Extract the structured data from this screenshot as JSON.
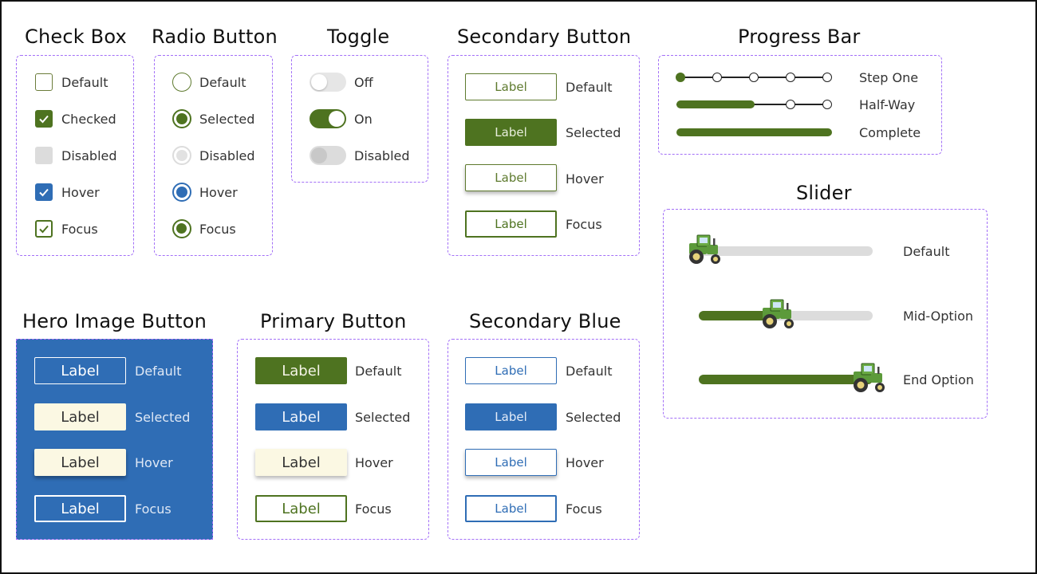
{
  "sections": {
    "checkbox": {
      "title": "Check Box",
      "items": [
        "Default",
        "Checked",
        "Disabled",
        "Hover",
        "Focus"
      ]
    },
    "radio": {
      "title": "Radio Button",
      "items": [
        "Default",
        "Selected",
        "Disabled",
        "Hover",
        "Focus"
      ]
    },
    "toggle": {
      "title": "Toggle",
      "items": [
        "Off",
        "On",
        "Disabled"
      ]
    },
    "secondary": {
      "title": "Secondary Button",
      "button_label": "Label",
      "items": [
        "Default",
        "Selected",
        "Hover",
        "Focus"
      ]
    },
    "progress": {
      "title": "Progress Bar",
      "items": [
        "Step One",
        "Half-Way",
        "Complete"
      ],
      "values": [
        0.0,
        0.5,
        1.0
      ]
    },
    "slider": {
      "title": "Slider",
      "items": [
        "Default",
        "Mid-Option",
        "End Option"
      ],
      "values": [
        0.0,
        0.45,
        1.0
      ]
    },
    "hero": {
      "title": "Hero Image Button",
      "button_label": "Label",
      "items": [
        "Default",
        "Selected",
        "Hover",
        "Focus"
      ]
    },
    "primary": {
      "title": "Primary Button",
      "button_label": "Label",
      "items": [
        "Default",
        "Selected",
        "Hover",
        "Focus"
      ]
    },
    "secondary_blue": {
      "title": "Secondary Blue",
      "button_label": "Label",
      "items": [
        "Default",
        "Selected",
        "Hover",
        "Focus"
      ]
    }
  },
  "colors": {
    "green": "#4e7320",
    "blue": "#2f6db5",
    "cream": "#fbf8e3",
    "dashed_border": "#a370f7",
    "disabled_gray": "#dcdcdc"
  },
  "icons": {
    "check": "check-icon",
    "slider_thumb": "tractor-icon"
  }
}
